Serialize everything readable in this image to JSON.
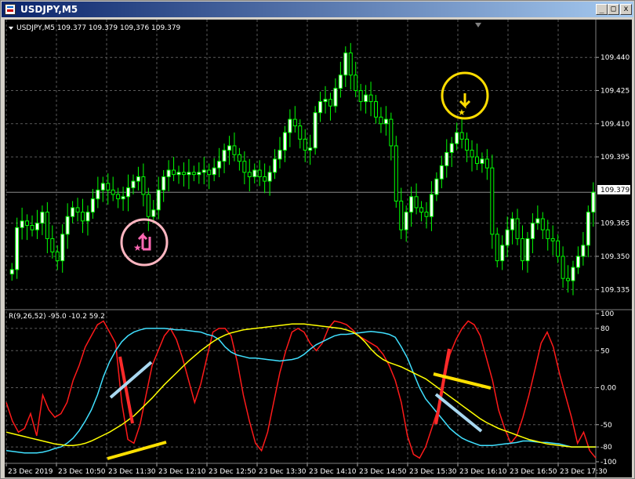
{
  "window": {
    "title": "USDJPY,M5",
    "controls": {
      "minimize": "_",
      "maximize": "□",
      "close": "x"
    }
  },
  "chart": {
    "header": "USDJPY,M5  109.377 109.379 109,376 109.379",
    "current_price": "109.379",
    "price_ticks": [
      "109.440",
      "109.425",
      "109.410",
      "109.395",
      "109.365",
      "109.350",
      "109.335"
    ],
    "indicator_header": "R(9,26,52) -95.0 -10.2 59.2",
    "indicator_ticks": [
      "100",
      "80",
      "50",
      "0.00",
      "-50",
      "-80",
      "-100"
    ],
    "time_ticks": [
      "23 Dec 2019",
      "23 Dec 10:50",
      "23 Dec 11:30",
      "23 Dec 12:10",
      "23 Dec 12:50",
      "23 Dec 13:30",
      "23 Dec 14:10",
      "23 Dec 14:50",
      "23 Dec 15:30",
      "23 Dec 16:10",
      "23 Dec 16:50",
      "23 Dec 17:30"
    ],
    "colors": {
      "background": "#000000",
      "candle": "#00ff00",
      "bull_body": "#ffffff",
      "bear_body": "#000000",
      "grid": "#5a5a5a",
      "red_line": "#ff1a1a",
      "cyan_line": "#40e0ff",
      "yellow_line": "#ffff00",
      "buy_marker": "#ff69b4",
      "sell_marker": "#ffdd00"
    },
    "markers": {
      "buy": {
        "label": "buy-arrow",
        "icon": "up-arrow-with-star"
      },
      "sell": {
        "label": "sell-arrow",
        "icon": "down-arrow-with-star"
      }
    }
  },
  "chart_data": {
    "type": "candlestick",
    "main_pane": {
      "closes": [
        109.344,
        109.363,
        109.366,
        109.364,
        109.362,
        109.365,
        109.37,
        109.358,
        109.352,
        109.348,
        109.36,
        109.368,
        109.372,
        109.37,
        109.366,
        109.37,
        109.376,
        109.38,
        109.383,
        109.38,
        109.378,
        109.376,
        109.377,
        109.381,
        109.384,
        109.386,
        109.378,
        109.368,
        109.371,
        109.38,
        109.386,
        109.389,
        109.387,
        109.388,
        109.387,
        109.388,
        109.387,
        109.388,
        109.389,
        109.387,
        109.39,
        109.393,
        109.398,
        109.4,
        109.396,
        109.393,
        109.388,
        109.386,
        109.389,
        109.386,
        109.384,
        109.388,
        109.394,
        109.398,
        109.406,
        109.412,
        109.409,
        109.403,
        109.398,
        109.399,
        109.415,
        109.42,
        109.421,
        109.418,
        109.426,
        109.432,
        109.442,
        109.432,
        109.425,
        109.42,
        109.423,
        109.42,
        109.413,
        109.41,
        109.412,
        109.4,
        109.375,
        109.362,
        109.37,
        109.377,
        109.372,
        109.37,
        109.368,
        109.378,
        109.385,
        109.391,
        109.397,
        109.401,
        109.406,
        109.403,
        109.398,
        109.395,
        109.392,
        109.394,
        109.39,
        109.36,
        109.348,
        109.355,
        109.362,
        109.367,
        109.358,
        109.348,
        109.358,
        109.365,
        109.367,
        109.362,
        109.358,
        109.357,
        109.35,
        109.34,
        109.339,
        109.345,
        109.35,
        109.355,
        109.37,
        109.379
      ],
      "ylim": [
        109.328,
        109.45
      ]
    },
    "indicator_pane": {
      "name": "R(9,26,52)",
      "ylim": [
        -100,
        100
      ],
      "series": [
        {
          "name": "R(9)",
          "color": "#ff1a1a",
          "values": [
            -20,
            -45,
            -60,
            -55,
            -35,
            -65,
            -10,
            -30,
            -40,
            -35,
            -20,
            10,
            30,
            55,
            70,
            85,
            90,
            75,
            60,
            -20,
            -70,
            -75,
            -50,
            -10,
            30,
            50,
            70,
            80,
            65,
            40,
            10,
            -20,
            5,
            40,
            75,
            80,
            80,
            70,
            35,
            -10,
            -45,
            -75,
            -85,
            -60,
            -20,
            20,
            50,
            75,
            80,
            75,
            60,
            50,
            60,
            80,
            90,
            88,
            85,
            78,
            70,
            65,
            60,
            55,
            45,
            30,
            10,
            -20,
            -65,
            -90,
            -95,
            -80,
            -55,
            -30,
            10,
            45,
            65,
            80,
            90,
            85,
            70,
            40,
            10,
            -30,
            -55,
            -75,
            -65,
            -40,
            -10,
            25,
            60,
            75,
            55,
            20,
            -10,
            -40,
            -75,
            -60,
            -85,
            -95
          ]
        },
        {
          "name": "R(26)",
          "color": "#40e0ff",
          "values": [
            -85,
            -86,
            -87,
            -88,
            -88,
            -88,
            -87,
            -85,
            -82,
            -80,
            -75,
            -68,
            -58,
            -45,
            -30,
            -10,
            15,
            35,
            50,
            62,
            70,
            75,
            78,
            80,
            80,
            80,
            80,
            79,
            78,
            78,
            77,
            76,
            75,
            72,
            70,
            65,
            55,
            48,
            44,
            42,
            40,
            40,
            39,
            38,
            37,
            36,
            37,
            38,
            40,
            45,
            52,
            58,
            62,
            66,
            70,
            72,
            72,
            73,
            74,
            75,
            76,
            75,
            74,
            72,
            68,
            55,
            40,
            20,
            0,
            -15,
            -25,
            -35,
            -45,
            -55,
            -62,
            -68,
            -72,
            -75,
            -78,
            -78,
            -78,
            -77,
            -76,
            -75,
            -74,
            -72,
            -72,
            -73,
            -74,
            -74,
            -75,
            -76,
            -78,
            -80,
            -80,
            -80,
            -80,
            -80
          ]
        },
        {
          "name": "R(52)",
          "color": "#ffff00",
          "values": [
            -60,
            -62,
            -64,
            -66,
            -68,
            -70,
            -72,
            -74,
            -76,
            -77,
            -78,
            -78,
            -77,
            -75,
            -72,
            -68,
            -64,
            -60,
            -55,
            -50,
            -44,
            -38,
            -30,
            -22,
            -14,
            -5,
            4,
            12,
            20,
            28,
            36,
            43,
            50,
            56,
            62,
            67,
            71,
            74,
            76,
            78,
            79,
            80,
            81,
            82,
            83,
            84,
            85,
            86,
            86,
            86,
            85,
            84,
            83,
            82,
            81,
            80,
            78,
            75,
            70,
            62,
            52,
            44,
            38,
            34,
            31,
            28,
            24,
            20,
            16,
            12,
            6,
            0,
            -6,
            -12,
            -18,
            -24,
            -30,
            -36,
            -42,
            -47,
            -51,
            -55,
            -58,
            -61,
            -64,
            -67,
            -70,
            -72,
            -74,
            -76,
            -77,
            -78,
            -79,
            -80,
            -80,
            -80,
            -80,
            -80
          ]
        }
      ]
    }
  }
}
